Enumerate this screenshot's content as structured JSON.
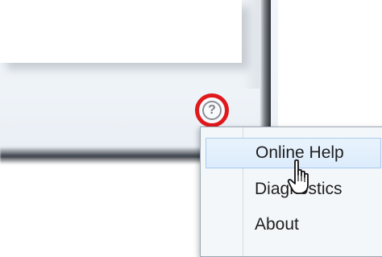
{
  "help_button": {
    "icon": "help-circle-icon",
    "glyph": "?",
    "highlight_color": "#e0191d"
  },
  "menu": {
    "items": [
      {
        "label": "Online Help",
        "state": "hover"
      },
      {
        "label": "Diagnostics"
      },
      {
        "label": "About"
      }
    ]
  },
  "cursor": {
    "icon": "hand-pointer-icon"
  }
}
